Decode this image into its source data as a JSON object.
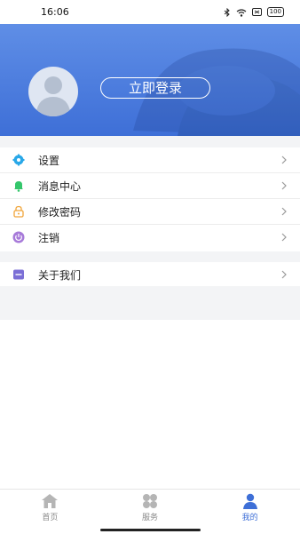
{
  "status_bar": {
    "time": "16:06",
    "icons": [
      "bluetooth-icon",
      "wifi-icon",
      "sim-icon",
      "battery-icon"
    ],
    "battery": "100"
  },
  "header": {
    "login_label": "立即登录",
    "bg_color": "#4a7de0"
  },
  "menu": {
    "items": [
      {
        "label": "设置",
        "icon": "gear-icon",
        "color": "#29a8e8"
      },
      {
        "label": "消息中心",
        "icon": "bell-icon",
        "color": "#34c66b"
      },
      {
        "label": "修改密码",
        "icon": "lock-icon",
        "color": "#f0a53a"
      },
      {
        "label": "注销",
        "icon": "power-icon",
        "color": "#a77ad9"
      }
    ],
    "secondary": [
      {
        "label": "关于我们",
        "icon": "about-icon",
        "color": "#7b6fd6"
      }
    ]
  },
  "tabbar": {
    "items": [
      {
        "label": "首页",
        "icon": "home-icon"
      },
      {
        "label": "服务",
        "icon": "grid-icon"
      },
      {
        "label": "我的",
        "icon": "person-icon",
        "active": true
      }
    ],
    "active_color": "#3e6fd7",
    "inactive_color": "#8a8a8a"
  }
}
